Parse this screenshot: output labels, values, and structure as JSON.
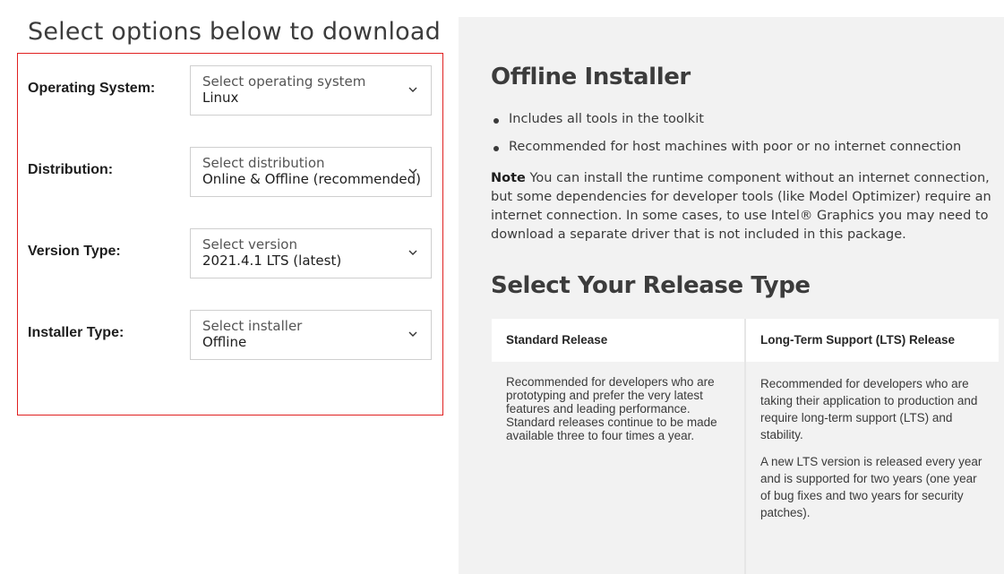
{
  "page": {
    "heading": "Select options below to download"
  },
  "options": [
    {
      "label": "Operating System:",
      "placeholder": "Select operating system",
      "value": "Linux"
    },
    {
      "label": "Distribution:",
      "placeholder": "Select distribution",
      "value": "Online & Offline (recommended)"
    },
    {
      "label": "Version Type:",
      "placeholder": "Select version",
      "value": "2021.4.1 LTS (latest)"
    },
    {
      "label": "Installer Type:",
      "placeholder": "Select installer",
      "value": "Offline"
    }
  ],
  "installer_info": {
    "title": "Offline Installer",
    "bullets": [
      "Includes all tools in the toolkit",
      "Recommended for host machines with poor or no internet connection"
    ],
    "note_label": "Note",
    "note_text": " You can install the runtime component without an internet connection, but some dependencies for developer tools (like Model Optimizer) require an internet connection. In some cases, to use Intel® Graphics you may need to download a separate driver that is not included in this package."
  },
  "release_type": {
    "title": "Select Your Release Type",
    "standard": {
      "header": "Standard Release",
      "body": "Recommended for developers who are prototyping and prefer the very latest features and leading performance. Standard releases continue to be made available three to four times a year."
    },
    "lts": {
      "header": "Long-Term Support (LTS) Release",
      "body1": "Recommended for developers who are taking their application to production and require long-term support (LTS) and stability.",
      "body2": "A new LTS version is released every year and is supported for two years (one year of bug fixes and two years for security patches)."
    }
  },
  "icons": {
    "dropdown": "chevron-down-icon"
  },
  "colors": {
    "highlight_border": "#e02020",
    "panel_background": "#f2f2f2"
  }
}
